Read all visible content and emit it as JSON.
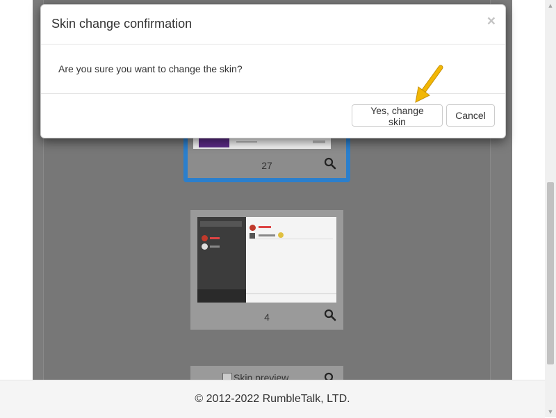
{
  "modal": {
    "title": "Skin change confirmation",
    "close_symbol": "×",
    "body_text": "Are you sure you want to change the skin?",
    "confirm_label": "Yes, change skin",
    "cancel_label": "Cancel"
  },
  "skins": [
    {
      "number": "27",
      "selected": true
    },
    {
      "number": "4",
      "selected": false
    },
    {
      "alt_text": "Skin preview"
    }
  ],
  "footer": {
    "text": "© 2012-2022 RumbleTalk, LTD."
  },
  "colors": {
    "selected_border": "#2b7fcc",
    "arrow": "#f2b705"
  },
  "icons": {
    "search": "search-icon",
    "close": "close-icon",
    "arrow": "pointer-arrow-icon"
  }
}
